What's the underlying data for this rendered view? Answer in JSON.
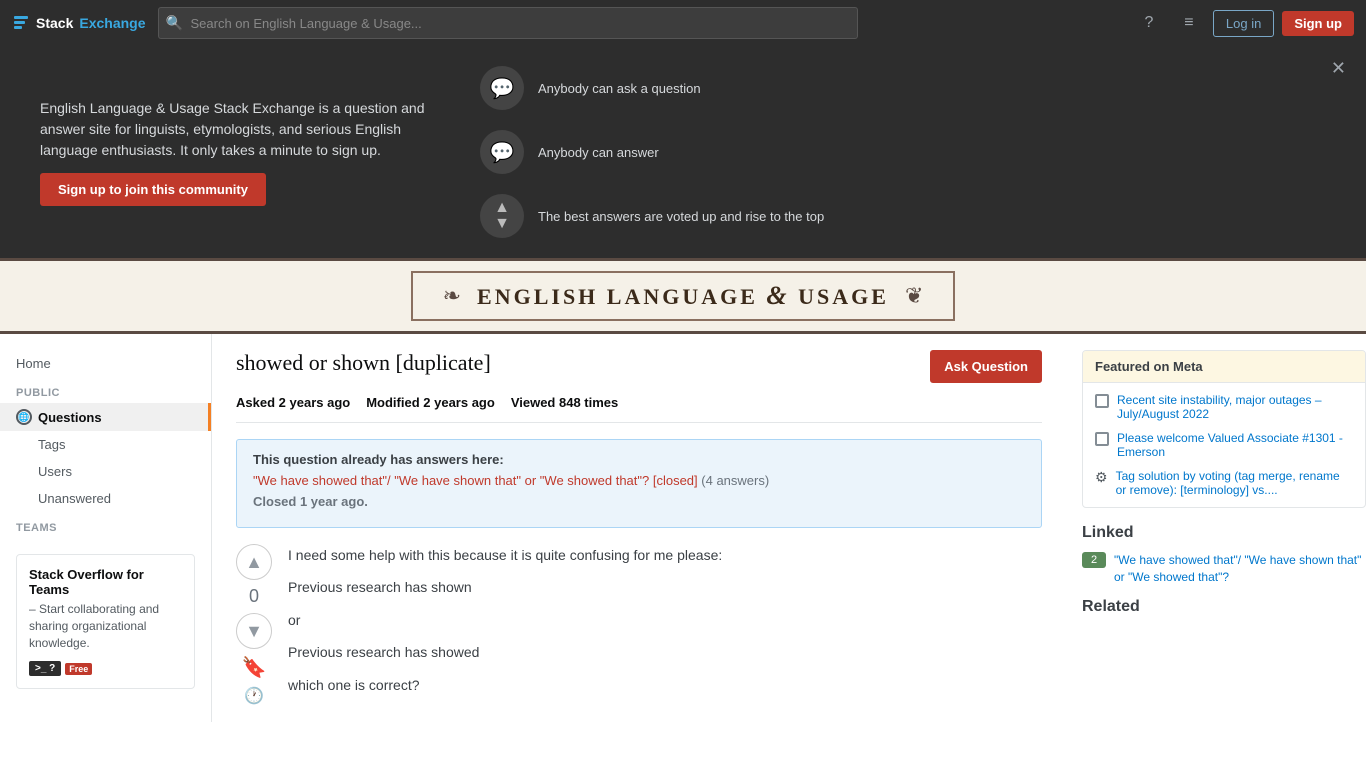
{
  "topbar": {
    "logo_stack": "Stack",
    "logo_exchange": "Exchange",
    "search_placeholder": "Search on English Language & Usage...",
    "login_label": "Log in",
    "signup_label": "Sign up"
  },
  "hero": {
    "description": "English Language & Usage Stack Exchange is a question and answer site for linguists, etymologists, and serious English language enthusiasts. It only takes a minute to sign up.",
    "join_button": "Sign up to join this community",
    "features": [
      {
        "text": "Anybody can ask a question",
        "icon": "💬"
      },
      {
        "text": "Anybody can answer",
        "icon": "💬"
      },
      {
        "text": "The best answers are voted up and rise to the top",
        "icon": "▲▼"
      }
    ]
  },
  "site_header": {
    "title_part1": "ENGLISH LANGUAGE",
    "title_amp": "&",
    "title_part2": "USAGE"
  },
  "sidebar": {
    "home_label": "Home",
    "public_label": "PUBLIC",
    "questions_label": "Questions",
    "tags_label": "Tags",
    "users_label": "Users",
    "unanswered_label": "Unanswered",
    "teams_label": "TEAMS",
    "teams_title": "Stack Overflow for Teams",
    "teams_desc": "– Start collaborating and sharing organizational knowledge.",
    "teams_badge": ">_ ?",
    "free_badge": "Free"
  },
  "question": {
    "title": "showed or shown [duplicate]",
    "asked_label": "Asked",
    "asked_time": "2 years ago",
    "modified_label": "Modified",
    "modified_time": "2 years ago",
    "viewed_label": "Viewed",
    "viewed_count": "848 times",
    "vote_count": "0",
    "ask_button": "Ask Question",
    "duplicate_title": "This question already has answers here:",
    "duplicate_link": "\"We have showed that\"/ \"We have shown that\" or \"We showed that\"? [closed]",
    "duplicate_answers": "(4 answers)",
    "closed_notice": "Closed 1 year ago.",
    "body_line1": "I need some help with this because it is quite confusing for me please:",
    "body_line2": "Previous research has shown",
    "body_line3": "or",
    "body_line4": "Previous research has showed",
    "body_line5": "which one is correct?"
  },
  "right_sidebar": {
    "featured_meta_title": "Featured on Meta",
    "meta_items": [
      {
        "text": "Recent site instability, major outages – July/August 2022",
        "type": "meta"
      },
      {
        "text": "Please welcome Valued Associate #1301 - Emerson",
        "type": "meta"
      },
      {
        "text": "Tag solution by voting (tag merge, rename or remove): [terminology] vs....",
        "type": "meta-special"
      }
    ],
    "linked_title": "Linked",
    "linked_items": [
      {
        "score": "2",
        "text": "\"We have showed that\"/ \"We have shown that\" or \"We showed that\"?"
      }
    ],
    "related_title": "Related"
  }
}
